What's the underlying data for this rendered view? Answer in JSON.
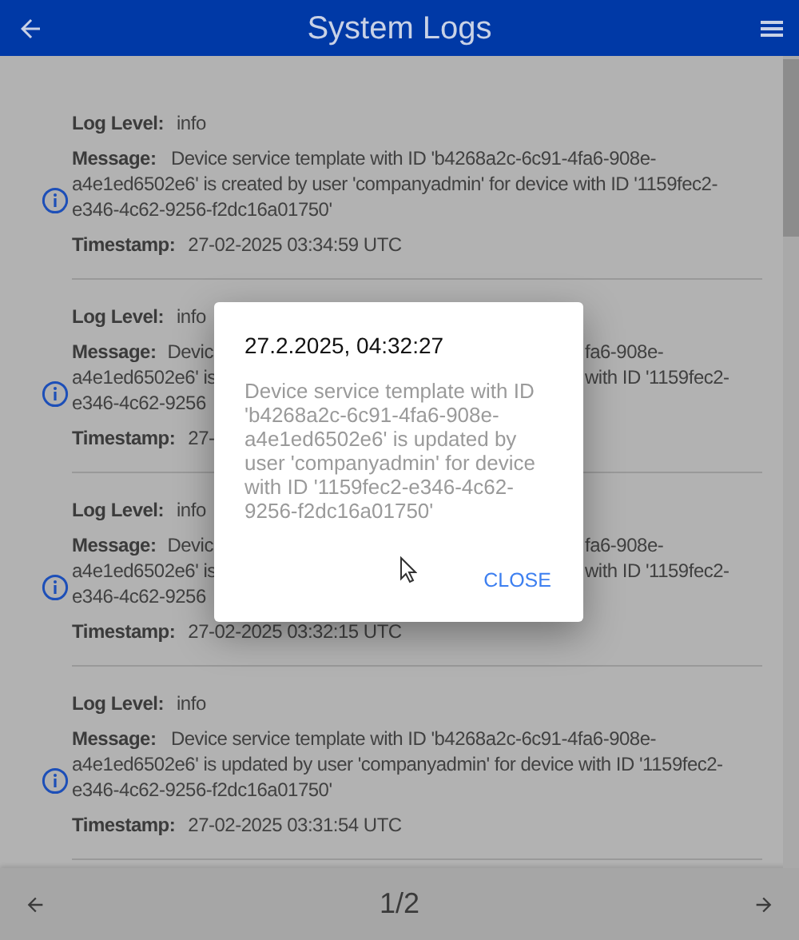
{
  "header": {
    "title": "System Logs"
  },
  "logs": [
    {
      "kind": "full",
      "level_label": "Log Level:",
      "level": "info",
      "message_label": "Message:",
      "message": "Device service template with ID 'b4268a2c-6c91-4fa6-908e-a4e1ed6502e6' is created by user 'companyadmin' for device with ID '1159fec2-e346-4c62-9256-f2dc16a01750'",
      "timestamp_label": "Timestamp:",
      "timestamp": "27-02-2025 03:34:59 UTC"
    },
    {
      "kind": "covered",
      "level_label": "Log Level:",
      "level": "info",
      "message_label": "Message:",
      "lines": [
        {
          "left": "Devic",
          "right": "fa6-908e-"
        },
        {
          "left": "a4e1ed6502e6' is",
          "right": "with ID '1159fec2-"
        },
        {
          "left": "e346-4c62-9256"
        }
      ],
      "timestamp_label": "Timestamp:",
      "timestamp": "27-"
    },
    {
      "kind": "covered",
      "level_label": "Log Level:",
      "level": "info",
      "message_label": "Message:",
      "lines": [
        {
          "left": "Devic",
          "right": "fa6-908e-"
        },
        {
          "left": "a4e1ed6502e6' is",
          "right": "with ID '1159fec2-"
        },
        {
          "left": "e346-4c62-9256"
        }
      ],
      "timestamp_label": "Timestamp:",
      "timestamp": "27-02-2025 03:32:15 UTC"
    },
    {
      "kind": "full",
      "level_label": "Log Level:",
      "level": "info",
      "message_label": "Message:",
      "message": "Device service template with ID 'b4268a2c-6c91-4fa6-908e-a4e1ed6502e6' is updated by user 'companyadmin' for device with ID '1159fec2-e346-4c62-9256-f2dc16a01750'",
      "timestamp_label": "Timestamp:",
      "timestamp": "27-02-2025 03:31:54 UTC"
    }
  ],
  "dialog": {
    "title": "27.2.2025, 04:32:27",
    "message": "Device service template with ID 'b4268a2c-6c91-4fa6-908e-a4e1ed6502e6' is updated by user 'companyadmin' for device with ID '1159fec2-e346-4c62-9256-f2dc16a01750'",
    "button": "CLOSE"
  },
  "pagination": {
    "page": "1/2"
  }
}
